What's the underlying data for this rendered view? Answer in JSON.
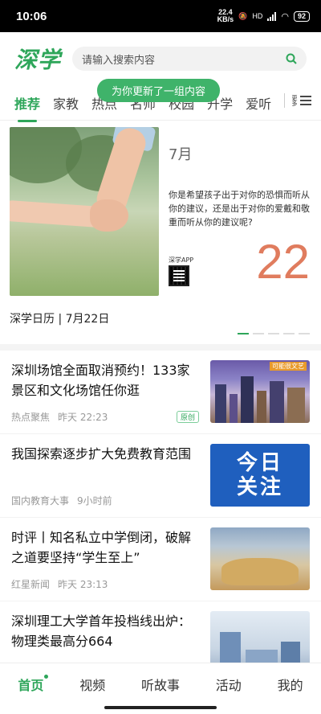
{
  "status": {
    "time": "10:06",
    "speed_value": "22.4",
    "speed_unit": "KB/s",
    "hd": "HD",
    "battery": "92"
  },
  "header": {
    "logo": "深学",
    "search_placeholder": "请输入搜索内容",
    "colors": {
      "accent": "#2ea65a"
    }
  },
  "tabs": [
    "推荐",
    "家教",
    "热点",
    "名师",
    "校园",
    "升学",
    "爱听"
  ],
  "tabs_more_text": "更多",
  "toast": "为你更新了一组内容",
  "banner": {
    "month": "7月",
    "quote": "你是希望孩子出于对你的恐惧而听从你的建议，还是出于对你的爱戴和敬重而听从你的建议呢?",
    "app_label": "深学APP",
    "day": "22",
    "caption": "深学日历 | 7月22日",
    "slide_index": 1,
    "slide_count": 5
  },
  "feed": [
    {
      "title": "深圳场馆全面取消预约！133家景区和文化场馆任你逛",
      "source": "热点聚焦",
      "time": "昨天 22:23",
      "tag": "原创"
    },
    {
      "title": "我国探索逐步扩大免费教育范围",
      "source": "国内教育大事",
      "time": "9小时前",
      "thumb_text": [
        "今日",
        "关注"
      ]
    },
    {
      "title": "时评丨知名私立中学倒闭，破解之道要坚持“学生至上”",
      "source": "红星新闻",
      "time": "昨天 23:13"
    },
    {
      "title": "深圳理工大学首年投档线出炉：物理类最高分664",
      "source": "",
      "time": ""
    }
  ],
  "thumb1_label": "可能很文艺",
  "bottom_nav": [
    "首页",
    "视频",
    "听故事",
    "活动",
    "我的"
  ]
}
